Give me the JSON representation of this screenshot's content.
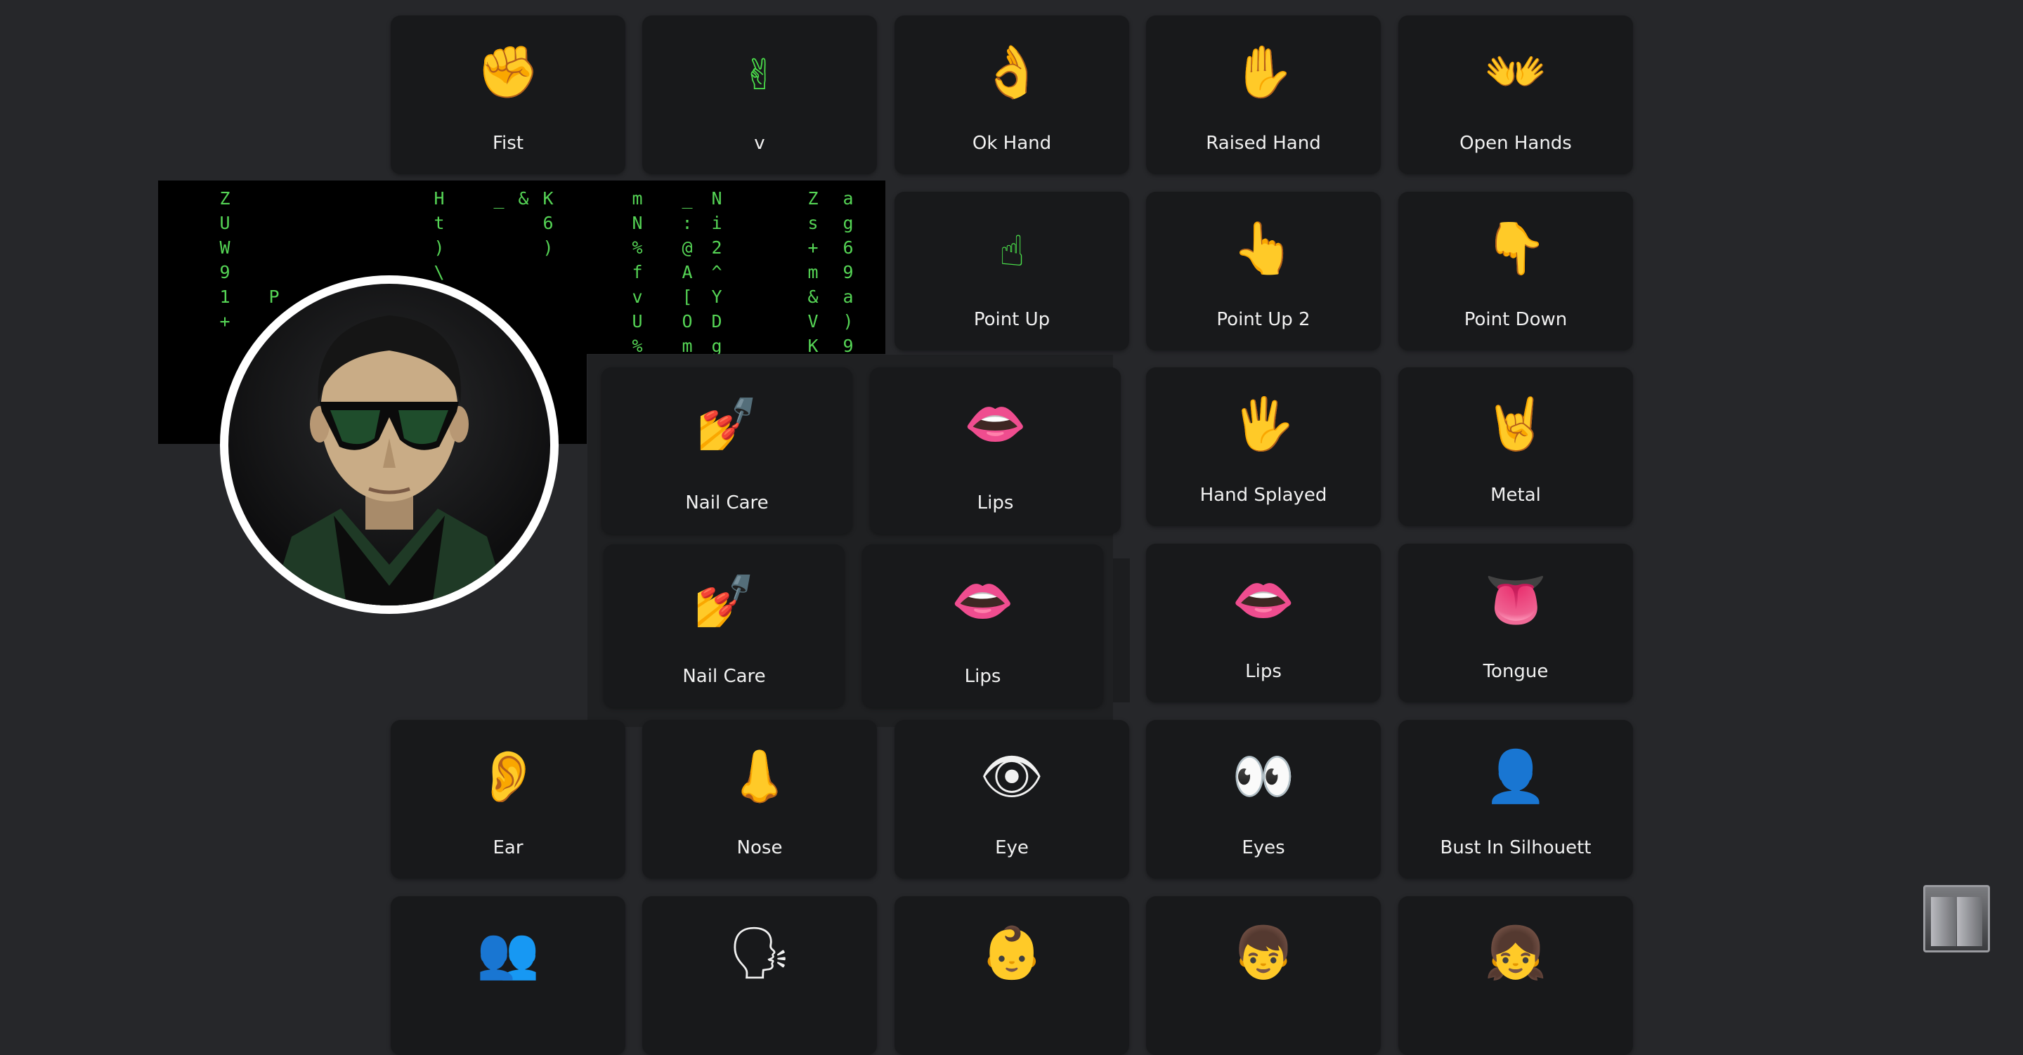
{
  "cards": [
    {
      "id": "fist",
      "emoji": "✊",
      "label": "Fist"
    },
    {
      "id": "v",
      "emoji": "✌",
      "label": "v"
    },
    {
      "id": "ok-hand",
      "emoji": "👌",
      "label": "Ok Hand"
    },
    {
      "id": "raised-hand",
      "emoji": "✋",
      "label": "Raised Hand"
    },
    {
      "id": "open-hands",
      "emoji": "👐",
      "label": "Open Hands"
    },
    {
      "id": "point-up",
      "emoji": "☝",
      "label": "Point Up"
    },
    {
      "id": "point-up-2",
      "emoji": "👆",
      "label": "Point Up 2"
    },
    {
      "id": "point-down",
      "emoji": "👇",
      "label": "Point Down"
    },
    {
      "id": "nail-care-a",
      "emoji": "💅",
      "label": "Nail Care"
    },
    {
      "id": "lips-a",
      "emoji": "👄",
      "label": "Lips"
    },
    {
      "id": "hand-splayed",
      "emoji": "🖐",
      "label": "Hand Splayed"
    },
    {
      "id": "metal",
      "emoji": "🤘",
      "label": "Metal"
    },
    {
      "id": "nail-care-b",
      "emoji": "💅",
      "label": "Nail Care"
    },
    {
      "id": "lips-b",
      "emoji": "👄",
      "label": "Lips"
    },
    {
      "id": "lips-c",
      "emoji": "👄",
      "label": "Lips"
    },
    {
      "id": "tongue",
      "emoji": "👅",
      "label": "Tongue"
    },
    {
      "id": "ear",
      "emoji": "👂",
      "label": "Ear"
    },
    {
      "id": "nose",
      "emoji": "👃",
      "label": "Nose"
    },
    {
      "id": "eye",
      "emoji": "👁",
      "label": "Eye"
    },
    {
      "id": "eyes",
      "emoji": "👀",
      "label": "Eyes"
    },
    {
      "id": "bust-in-silhouette",
      "emoji": "👤",
      "label": "Bust In Silhouett"
    },
    {
      "id": "busts-in-silhouette",
      "emoji": "👥",
      "label": ""
    },
    {
      "id": "speaking-head",
      "emoji": "🗣",
      "label": ""
    },
    {
      "id": "baby",
      "emoji": "👶",
      "label": ""
    },
    {
      "id": "boy",
      "emoji": "👦",
      "label": ""
    },
    {
      "id": "girl",
      "emoji": "👧",
      "label": ""
    }
  ],
  "matrix": {
    "columns": [
      "Z\nU\nW\n9\n1\n+\n_",
      "\n\n\n\nP",
      "H\nt\n)\n\\",
      "_",
      "&",
      "K\n6\n)",
      "m\nN\n%\nf\nv\nU\n%",
      "_\n:\n@\nA\n[\nO\nm",
      "N\ni\n2\n^\nY\nD\ng",
      "Z\ns\n+\nm\n&\nV\nK",
      "a\ng\n6\n9\na\n)\n9"
    ]
  },
  "avatar": {
    "icon": "avatar-neo-icon"
  },
  "elevator": {
    "icon": "elevator-icon"
  }
}
